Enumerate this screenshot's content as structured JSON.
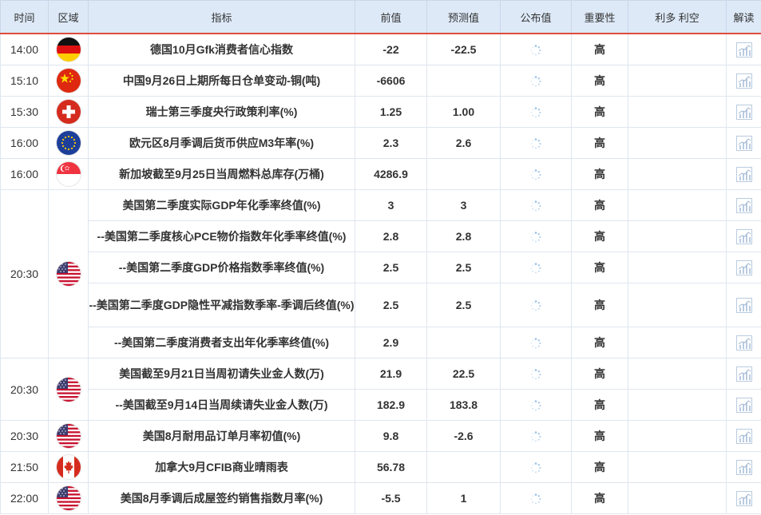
{
  "header": {
    "time": "时间",
    "region": "区域",
    "indicator": "指标",
    "previous": "前值",
    "forecast": "预测值",
    "actual": "公布值",
    "importance": "重要性",
    "bull_bear": "利多 利空",
    "analysis": "解读"
  },
  "icons": {
    "pending": "loading-spinner-icon",
    "analysis": "bar-chart-icon"
  },
  "colors": {
    "accent": "#c8261b",
    "header_bg": "#dde9f7",
    "header_border": "#e04c3c"
  },
  "groups": [
    {
      "time": "14:00",
      "flag": "germany",
      "rows": [
        {
          "indicator": "德国10月Gfk消费者信心指数",
          "previous": "-22",
          "forecast": "-22.5",
          "importance": "高"
        }
      ]
    },
    {
      "time": "15:10",
      "flag": "china",
      "rows": [
        {
          "indicator": "中国9月26日上期所每日仓单变动-铜(吨)",
          "previous": "-6606",
          "forecast": "",
          "importance": "高"
        }
      ]
    },
    {
      "time": "15:30",
      "flag": "switzerland",
      "rows": [
        {
          "indicator": "瑞士第三季度央行政策利率(%)",
          "previous": "1.25",
          "forecast": "1.00",
          "importance": "高"
        }
      ]
    },
    {
      "time": "16:00",
      "flag": "eu",
      "rows": [
        {
          "indicator": "欧元区8月季调后货币供应M3年率(%)",
          "previous": "2.3",
          "forecast": "2.6",
          "importance": "高"
        }
      ]
    },
    {
      "time": "16:00",
      "flag": "singapore",
      "rows": [
        {
          "indicator": "新加坡截至9月25日当周燃料总库存(万桶)",
          "previous": "4286.9",
          "forecast": "",
          "importance": "高"
        }
      ]
    },
    {
      "time": "20:30",
      "flag": "usa",
      "rows": [
        {
          "indicator": "美国第二季度实际GDP年化季率终值(%)",
          "previous": "3",
          "forecast": "3",
          "importance": "高"
        },
        {
          "indicator": "--美国第二季度核心PCE物价指数年化季率终值(%)",
          "previous": "2.8",
          "forecast": "2.8",
          "importance": "高"
        },
        {
          "indicator": "--美国第二季度GDP价格指数季率终值(%)",
          "previous": "2.5",
          "forecast": "2.5",
          "importance": "高"
        },
        {
          "indicator": "--美国第二季度GDP隐性平减指数季率-季调后终值(%)",
          "previous": "2.5",
          "forecast": "2.5",
          "importance": "高",
          "tall": true
        },
        {
          "indicator": "--美国第二季度消费者支出年化季率终值(%)",
          "previous": "2.9",
          "forecast": "",
          "importance": "高"
        }
      ]
    },
    {
      "time": "20:30",
      "flag": "usa",
      "rows": [
        {
          "indicator": "美国截至9月21日当周初请失业金人数(万)",
          "previous": "21.9",
          "forecast": "22.5",
          "importance": "高"
        },
        {
          "indicator": "--美国截至9月14日当周续请失业金人数(万)",
          "previous": "182.9",
          "forecast": "183.8",
          "importance": "高"
        }
      ]
    },
    {
      "time": "20:30",
      "flag": "usa",
      "rows": [
        {
          "indicator": "美国8月耐用品订单月率初值(%)",
          "previous": "9.8",
          "forecast": "-2.6",
          "importance": "高"
        }
      ]
    },
    {
      "time": "21:50",
      "flag": "canada",
      "rows": [
        {
          "indicator": "加拿大9月CFIB商业晴雨表",
          "previous": "56.78",
          "forecast": "",
          "importance": "高"
        }
      ]
    },
    {
      "time": "22:00",
      "flag": "usa",
      "rows": [
        {
          "indicator": "美国8月季调后成屋签约销售指数月率(%)",
          "previous": "-5.5",
          "forecast": "1",
          "importance": "高"
        }
      ]
    }
  ]
}
